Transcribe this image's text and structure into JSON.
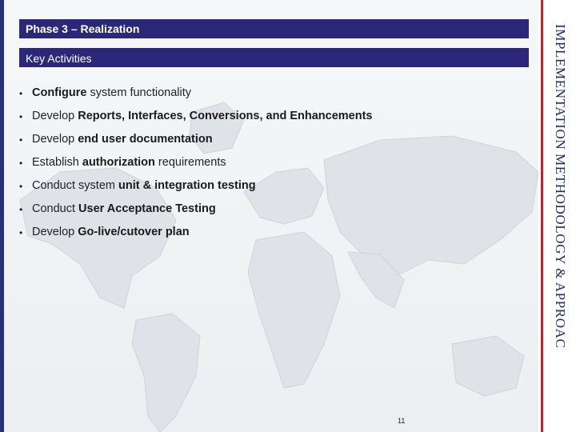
{
  "slide": {
    "phase_title": "Phase 3 – Realization",
    "section_title": "Key Activities",
    "side_title": "IMPLEMENTATION METHODOLOGY & APPROACH",
    "page_number": "11",
    "colors": {
      "header_bar": "#2b2879",
      "side_title": "#1f2a6e",
      "accent_red": "#cc1f2a"
    }
  },
  "bullets": [
    {
      "pre": "",
      "bold": "Configure",
      "post": " system functionality"
    },
    {
      "pre": "Develop ",
      "bold": "Reports, Interfaces, Conversions, and  Enhancements",
      "post": ""
    },
    {
      "pre": "Develop ",
      "bold": "end user documentation",
      "post": ""
    },
    {
      "pre": "Establish ",
      "bold": "authorization",
      "post": " requirements"
    },
    {
      "pre": "Conduct system ",
      "bold": "unit & integration testing",
      "post": ""
    },
    {
      "pre": "Conduct ",
      "bold": "User Acceptance Testing",
      "post": ""
    },
    {
      "pre": "Develop ",
      "bold": "Go-live/cutover plan",
      "post": ""
    }
  ],
  "bullet_symbol": "•"
}
